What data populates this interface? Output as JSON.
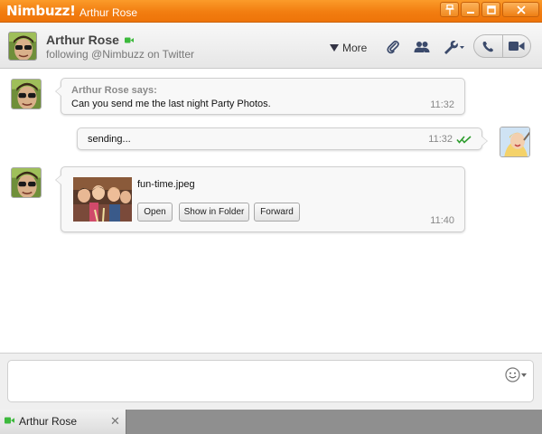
{
  "window": {
    "brand": "Nimbuzz!",
    "title": "Arthur Rose"
  },
  "header": {
    "contact_name": "Arthur Rose",
    "status": "following @Nimbuzz on Twitter",
    "more_label": "More"
  },
  "messages": [
    {
      "sender": "Arthur Rose says:",
      "text": "Can you send me the last night Party Photos.",
      "time": "11:32"
    },
    {
      "text": "sending...",
      "time": "11:32"
    },
    {
      "file_name": "fun-time.jpeg",
      "buttons": [
        "Open",
        "Show in Folder",
        "Forward"
      ],
      "time": "11:40"
    }
  ],
  "input": {
    "value": ""
  },
  "tabs": [
    {
      "label": "Arthur Rose",
      "close_glyph": "✕"
    }
  ],
  "colors": {
    "accent": "#f27d10",
    "delivered_check": "#2e9d2e",
    "online": "#3cb93c"
  }
}
